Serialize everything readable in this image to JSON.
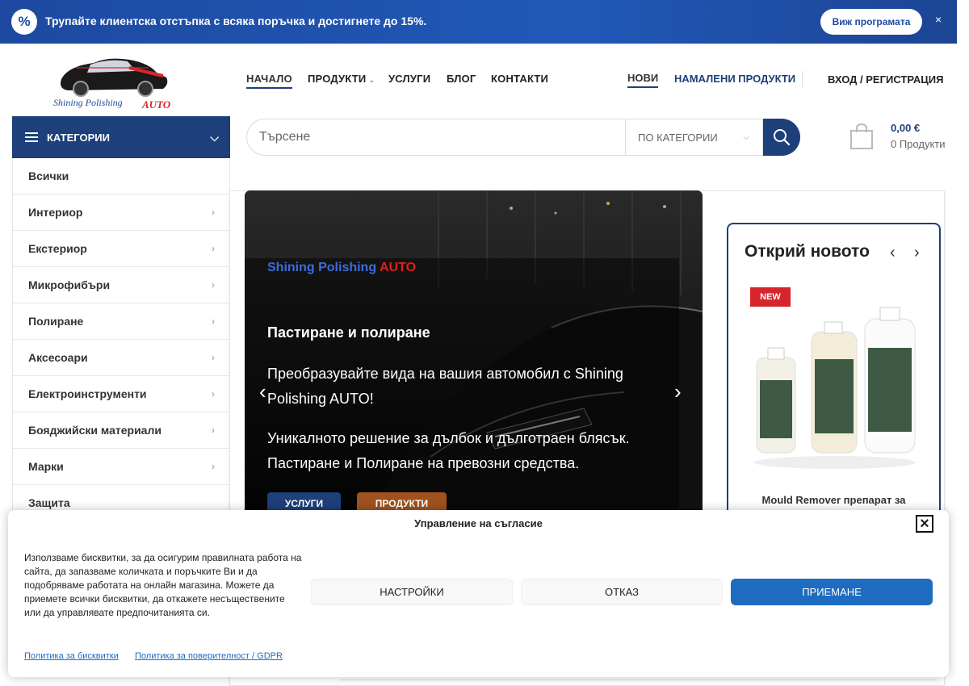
{
  "promo": {
    "text": "Трупайте клиентска отстъпка с всяка поръчка и достигнете до 15%.",
    "button": "Виж програмата",
    "close": "×",
    "badge": "%"
  },
  "logo": {
    "line1": "Shining Polishing",
    "line2": "AUTO"
  },
  "nav": {
    "home": "НАЧАЛО",
    "products": "ПРОДУКТИ",
    "services": "УСЛУГИ",
    "blog": "БЛОГ",
    "contacts": "КОНТАКТИ",
    "new": "НОВИ",
    "sale": "НАМАЛЕНИ ПРОДУКТИ",
    "login": "ВХОД / РЕГИСТРАЦИЯ"
  },
  "categories": {
    "title": "КАТЕГОРИИ",
    "items": [
      {
        "label": "Всички",
        "arrow": false
      },
      {
        "label": "Интериор",
        "arrow": true
      },
      {
        "label": "Екстериор",
        "arrow": true
      },
      {
        "label": "Микрофибъри",
        "arrow": true
      },
      {
        "label": "Полиране",
        "arrow": true
      },
      {
        "label": "Аксесоари",
        "arrow": true
      },
      {
        "label": "Електроинструменти",
        "arrow": true
      },
      {
        "label": "Бояджийски материали",
        "arrow": true
      },
      {
        "label": "Марки",
        "arrow": true
      },
      {
        "label": "Защита",
        "arrow": false
      }
    ]
  },
  "search": {
    "placeholder": "Търсене",
    "category": "ПО КАТЕГОРИИ"
  },
  "cart": {
    "total": "0,00 €",
    "count": "0 Продукти"
  },
  "hero": {
    "brand": "Shining Polishing",
    "brand_accent": "AUTO",
    "title": "Пастиране и полиране",
    "p1": "Преобразувайте вида на вашия автомобил с Shining Polishing AUTO!",
    "p2": "Уникалното решение за дълбок и дълготраен блясък. Пастиране и Полиране на превозни средства.",
    "btn_services": "УСЛУГИ",
    "btn_products": "ПРОДУКТИ"
  },
  "discover": {
    "title": "Открий новото",
    "badge": "NEW",
    "product_name": "Mould Remover препарат за"
  },
  "consent": {
    "title": "Управление на съгласие",
    "text": "Използваме бисквитки, за да осигурим правилната работа на сайта, да запазваме количката и поръчките Ви и да подобряваме работата на онлайн магазина. Можете да приемете всички бисквитки, да откажете несъществените или да управлявате предпочитанията си.",
    "settings": "НАСТРОЙКИ",
    "deny": "ОТКАЗ",
    "accept": "ПРИЕМАНЕ",
    "link_cookie": "Политика за бисквитки",
    "link_privacy": "Политика за поверителност / GDPR"
  },
  "colors": {
    "primary": "#1d3f7a",
    "promo": "#2158b8",
    "accent_red": "#d7262b",
    "accept": "#1e6bc0",
    "products_btn": "#a0521e"
  }
}
